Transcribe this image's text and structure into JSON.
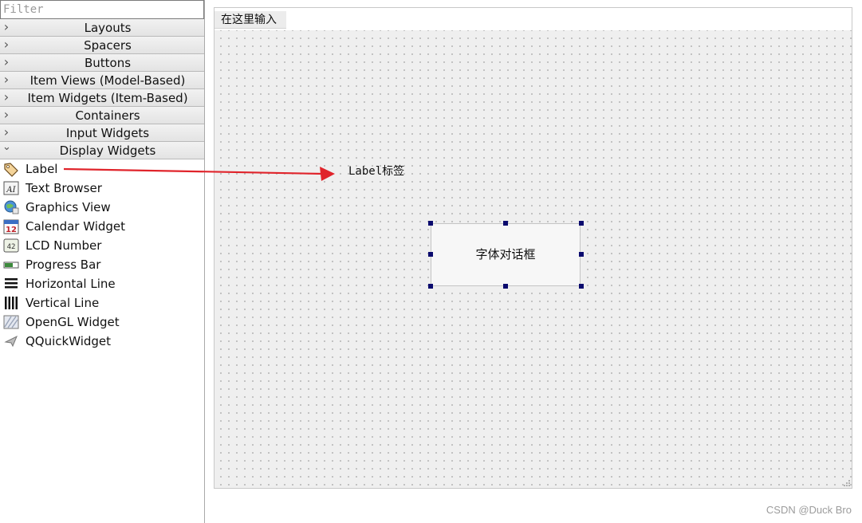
{
  "widget_box": {
    "filter_placeholder": "Filter",
    "categories": [
      {
        "label": "Layouts",
        "icon": "chevron-right-icon",
        "expanded": false
      },
      {
        "label": "Spacers",
        "icon": "chevron-right-icon",
        "expanded": false
      },
      {
        "label": "Buttons",
        "icon": "chevron-right-icon",
        "expanded": false
      },
      {
        "label": "Item Views (Model-Based)",
        "icon": "chevron-right-icon",
        "expanded": false
      },
      {
        "label": "Item Widgets (Item-Based)",
        "icon": "chevron-right-icon",
        "expanded": false
      },
      {
        "label": "Containers",
        "icon": "chevron-right-icon",
        "expanded": false
      },
      {
        "label": "Input Widgets",
        "icon": "chevron-right-icon",
        "expanded": false
      },
      {
        "label": "Display Widgets",
        "icon": "chevron-down-icon",
        "expanded": true
      }
    ],
    "display_widgets": [
      {
        "label": "Label",
        "icon": "label-tag-icon"
      },
      {
        "label": "Text Browser",
        "icon": "text-browser-icon"
      },
      {
        "label": "Graphics View",
        "icon": "graphics-view-icon"
      },
      {
        "label": "Calendar Widget",
        "icon": "calendar-icon"
      },
      {
        "label": "LCD Number",
        "icon": "lcd-number-icon"
      },
      {
        "label": "Progress Bar",
        "icon": "progress-bar-icon"
      },
      {
        "label": "Horizontal Line",
        "icon": "horizontal-line-icon"
      },
      {
        "label": "Vertical Line",
        "icon": "vertical-line-icon"
      },
      {
        "label": "OpenGL Widget",
        "icon": "opengl-widget-icon"
      },
      {
        "label": "QQuickWidget",
        "icon": "qquickwidget-icon"
      }
    ],
    "icon_glyphs": {
      "text_browser": "AI",
      "calendar": "12",
      "lcd": "42"
    }
  },
  "form": {
    "menu_placeholder": "在这里输入",
    "label_text": "Label标签",
    "button_text": "字体对话框"
  },
  "annotation": {
    "arrow_color": "#e0242b"
  },
  "watermark": "CSDN @Duck Bro",
  "colors": {
    "selection_handle": "#0a0a6e",
    "grid_background": "#efefef",
    "category_header": "#e8e8e8"
  }
}
